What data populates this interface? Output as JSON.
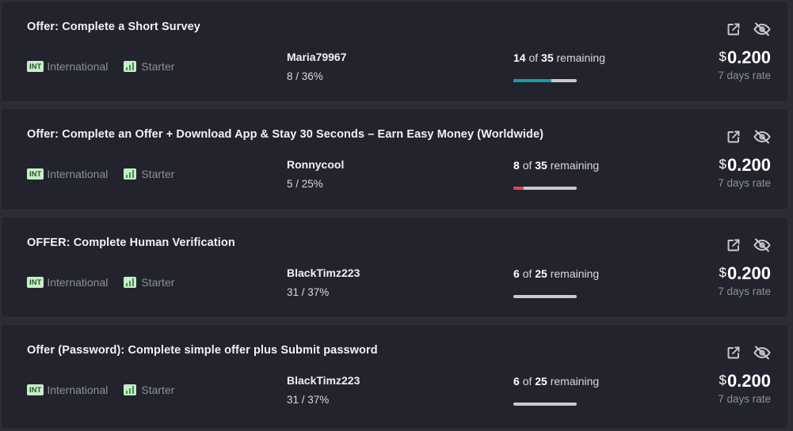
{
  "offers": [
    {
      "title": "Offer: Complete a Short Survey",
      "region_badge": "INT",
      "region_label": "International",
      "level_label": "Starter",
      "user_name": "Maria79967",
      "user_stats": "8 / 36%",
      "remaining_count": "14",
      "remaining_total": "35",
      "remaining_suffix": "remaining",
      "progress_percent": 60,
      "progress_color": "#1b9aaa",
      "currency": "$",
      "price": "0.200",
      "price_note": "7 days rate"
    },
    {
      "title": "Offer: Complete an Offer + Download App & Stay 30 Seconds – Earn Easy Money (Worldwide)",
      "region_badge": "INT",
      "region_label": "International",
      "level_label": "Starter",
      "user_name": "Ronnycool",
      "user_stats": "5 / 25%",
      "remaining_count": "8",
      "remaining_total": "35",
      "remaining_suffix": "remaining",
      "progress_percent": 16,
      "progress_color": "#e0484f",
      "currency": "$",
      "price": "0.200",
      "price_note": "7 days rate"
    },
    {
      "title": "OFFER: Complete Human Verification",
      "region_badge": "INT",
      "region_label": "International",
      "level_label": "Starter",
      "user_name": "BlackTimz223",
      "user_stats": "31 / 37%",
      "remaining_count": "6",
      "remaining_total": "25",
      "remaining_suffix": "remaining",
      "progress_percent": 0,
      "progress_color": "#c9cad1",
      "currency": "$",
      "price": "0.200",
      "price_note": "7 days rate"
    },
    {
      "title": "Offer (Password): Complete simple offer plus Submit password",
      "region_badge": "INT",
      "region_label": "International",
      "level_label": "Starter",
      "user_name": "BlackTimz223",
      "user_stats": "31 / 37%",
      "remaining_count": "6",
      "remaining_total": "25",
      "remaining_suffix": "remaining",
      "progress_percent": 0,
      "progress_color": "#c9cad1",
      "currency": "$",
      "price": "0.200",
      "price_note": "7 days rate"
    }
  ],
  "of_word": "of",
  "icons": {
    "open": "external-link-icon",
    "hide": "eye-off-icon"
  },
  "colors": {
    "card_bg": "#22232c",
    "page_bg": "#2b2c36",
    "badge_bg": "#c7ecc9"
  }
}
